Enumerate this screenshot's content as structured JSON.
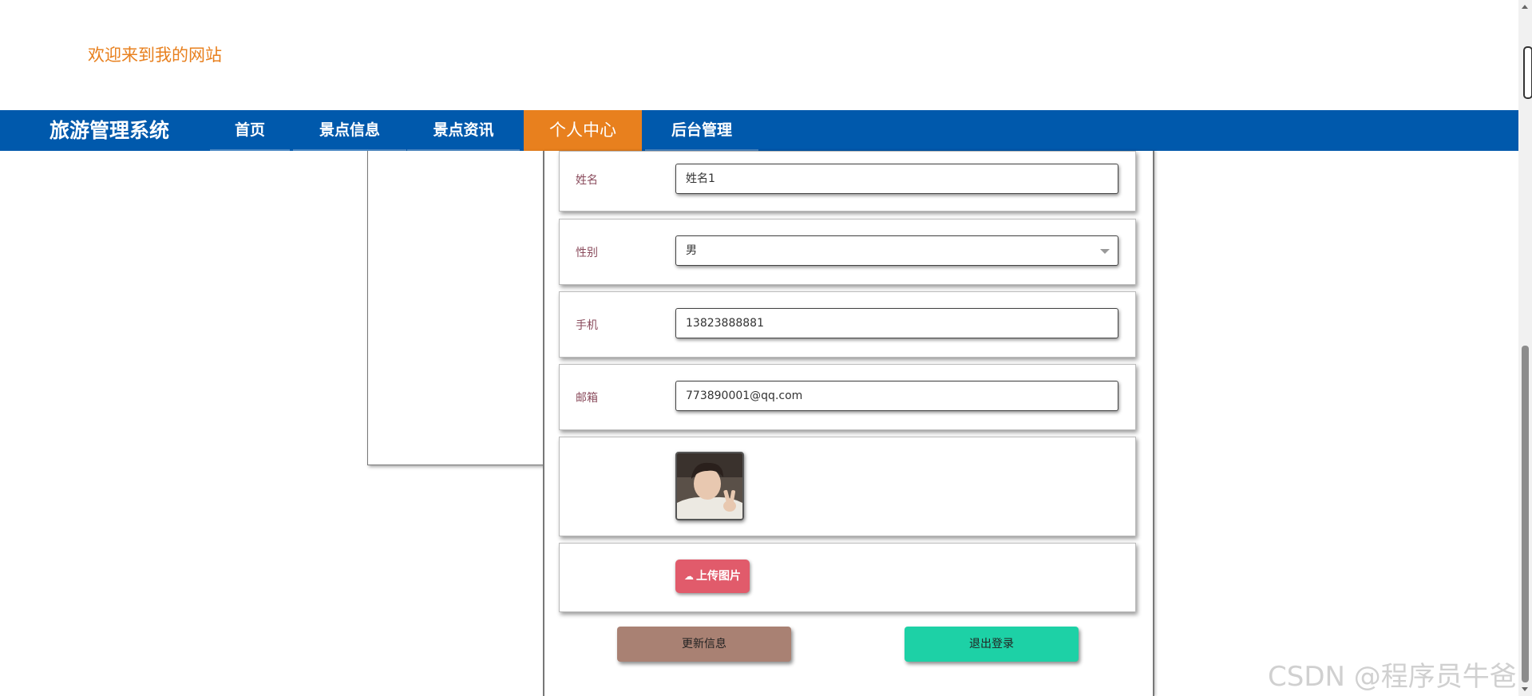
{
  "header": {
    "welcome": "欢迎来到我的网站"
  },
  "nav": {
    "brand": "旅游管理系统",
    "items": [
      {
        "label": "首页"
      },
      {
        "label": "景点信息"
      },
      {
        "label": "景点资讯"
      },
      {
        "label": "个人中心",
        "active": true
      },
      {
        "label": "后台管理"
      }
    ]
  },
  "form": {
    "name": {
      "label": "姓名",
      "value": "姓名1"
    },
    "gender": {
      "label": "性别",
      "value": "男"
    },
    "phone": {
      "label": "手机",
      "value": "13823888881"
    },
    "email": {
      "label": "邮箱",
      "value": "773890001@qq.com"
    },
    "upload_label": "上传图片"
  },
  "actions": {
    "update": "更新信息",
    "logout": "退出登录"
  },
  "watermark": "CSDN @程序员牛爸",
  "colors": {
    "nav_bg": "#0059ac",
    "accent": "#e8801e",
    "upload": "#e15b6b",
    "update": "#a98173",
    "logout": "#1dd1a6"
  }
}
